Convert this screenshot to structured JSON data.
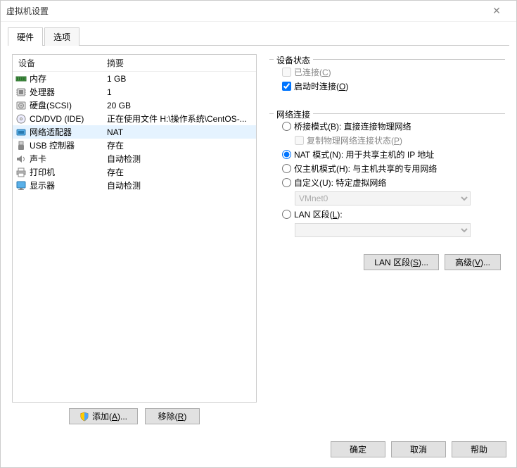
{
  "window": {
    "title": "虚拟机设置"
  },
  "tabs": {
    "hardware": "硬件",
    "options": "选项"
  },
  "device_header": {
    "name": "设备",
    "summary": "摘要"
  },
  "devices": [
    {
      "icon": "memory",
      "name": "内存",
      "summary": "1 GB"
    },
    {
      "icon": "cpu",
      "name": "处理器",
      "summary": "1"
    },
    {
      "icon": "disk",
      "name": "硬盘(SCSI)",
      "summary": "20 GB"
    },
    {
      "icon": "cd",
      "name": "CD/DVD (IDE)",
      "summary": "正在使用文件 H:\\操作系统\\CentOS-..."
    },
    {
      "icon": "net",
      "name": "网络适配器",
      "summary": "NAT",
      "selected": true
    },
    {
      "icon": "usb",
      "name": "USB 控制器",
      "summary": "存在"
    },
    {
      "icon": "sound",
      "name": "声卡",
      "summary": "自动检测"
    },
    {
      "icon": "printer",
      "name": "打印机",
      "summary": "存在"
    },
    {
      "icon": "display",
      "name": "显示器",
      "summary": "自动检测"
    }
  ],
  "buttons": {
    "add": "添加(A)...",
    "remove": "移除(R)",
    "lan_segments": "LAN 区段(S)...",
    "advanced": "高级(V)...",
    "ok": "确定",
    "cancel": "取消",
    "help": "帮助"
  },
  "device_state": {
    "legend": "设备状态",
    "connected": "已连接(C)",
    "connect_at_power_on": "启动时连接(O)"
  },
  "network": {
    "legend": "网络连接",
    "bridged": "桥接模式(B): 直接连接物理网络",
    "replicate": "复制物理网络连接状态(P)",
    "nat": "NAT 模式(N): 用于共享主机的 IP 地址",
    "hostonly": "仅主机模式(H): 与主机共享的专用网络",
    "custom": "自定义(U): 特定虚拟网络",
    "custom_value": "VMnet0",
    "lan_segment": "LAN 区段(L):"
  }
}
